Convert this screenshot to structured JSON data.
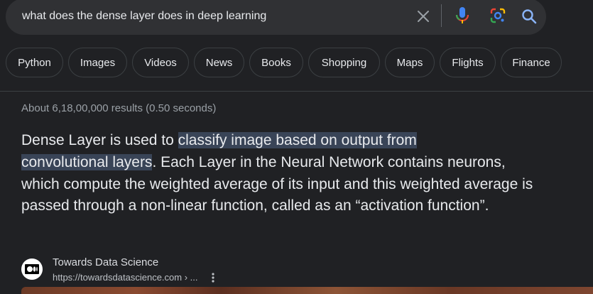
{
  "search": {
    "query": "what does the dense layer does in deep learning"
  },
  "chips": [
    {
      "label": "Python"
    },
    {
      "label": "Images"
    },
    {
      "label": "Videos"
    },
    {
      "label": "News"
    },
    {
      "label": "Books"
    },
    {
      "label": "Shopping"
    },
    {
      "label": "Maps"
    },
    {
      "label": "Flights"
    },
    {
      "label": "Finance"
    }
  ],
  "result_stats": "About 6,18,00,000 results (0.50 seconds)",
  "snippet": {
    "before": "Dense Layer is used to ",
    "highlight_line1": "classify image based on output from",
    "highlight_line2": "convolutional layers",
    "after": ". Each Layer in the Neural Network contains neurons, which compute the weighted average of its input and this weighted average is passed through a non-linear function, called as an “activation function”."
  },
  "source": {
    "name": "Towards Data Science",
    "url": "https://towardsdatascience.com › ...",
    "favicon_icon": "medium-logo-icon"
  },
  "colors": {
    "background": "#202124",
    "search_bar": "#303134",
    "highlight": "#394457"
  }
}
